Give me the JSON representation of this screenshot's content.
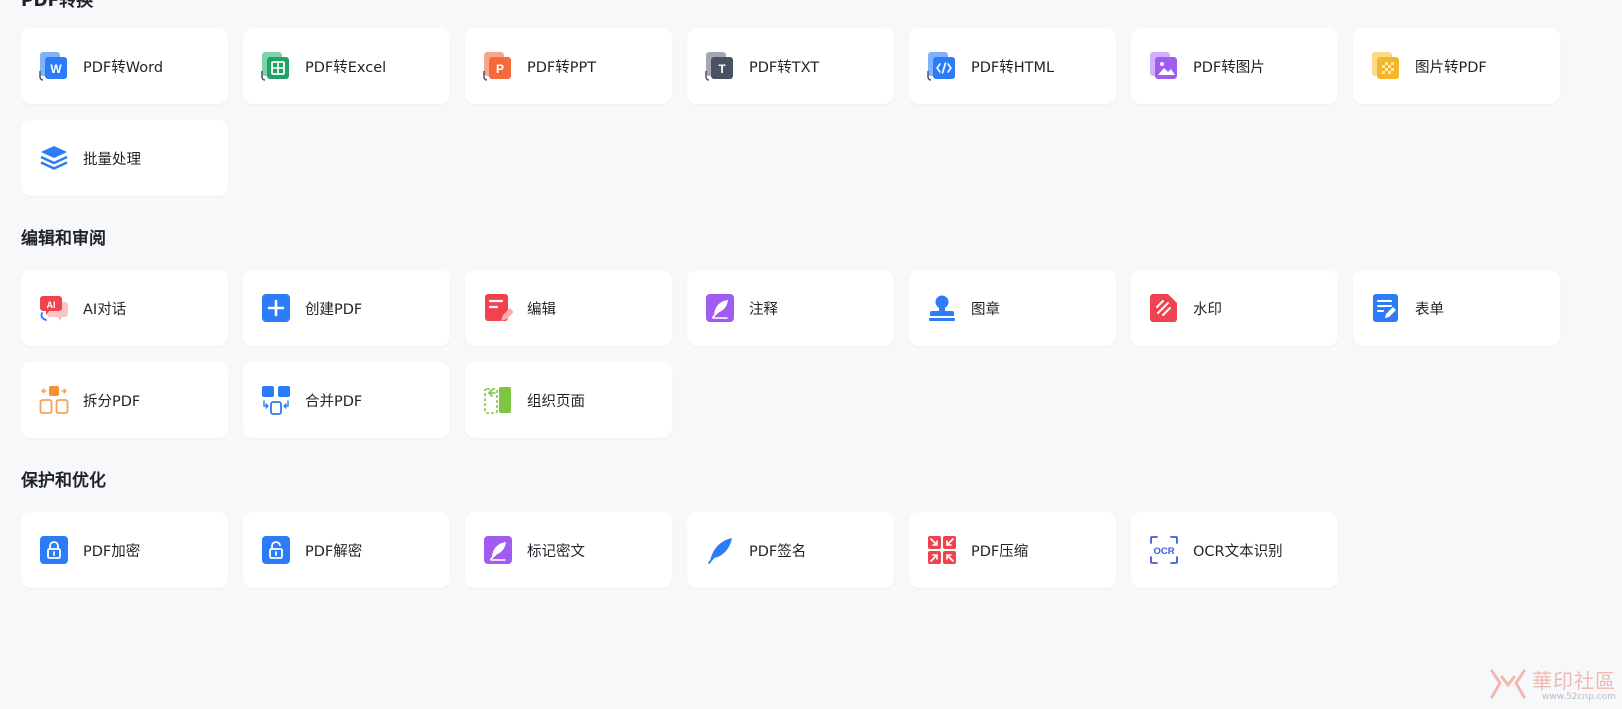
{
  "sections": [
    {
      "title": "PDF转换",
      "items": [
        {
          "label": "PDF转Word",
          "icon": "word-file-icon",
          "color": "#2b7cf6"
        },
        {
          "label": "PDF转Excel",
          "icon": "excel-file-icon",
          "color": "#21a366"
        },
        {
          "label": "PDF转PPT",
          "icon": "ppt-file-icon",
          "color": "#f36a3c"
        },
        {
          "label": "PDF转TXT",
          "icon": "txt-file-icon",
          "color": "#4a5262"
        },
        {
          "label": "PDF转HTML",
          "icon": "html-file-icon",
          "color": "#2b7cf6"
        },
        {
          "label": "PDF转图片",
          "icon": "image-file-icon",
          "color": "#a05bf0"
        },
        {
          "label": "图片转PDF",
          "icon": "image-to-pdf-icon",
          "color": "#f5b627"
        },
        {
          "label": "批量处理",
          "icon": "layers-icon",
          "color": "#2b7cf6"
        }
      ]
    },
    {
      "title": "编辑和审阅",
      "items": [
        {
          "label": "AI对话",
          "icon": "ai-chat-icon",
          "color": "#f0424f"
        },
        {
          "label": "创建PDF",
          "icon": "create-plus-icon",
          "color": "#2b7cf6"
        },
        {
          "label": "编辑",
          "icon": "edit-doc-icon",
          "color": "#f0424f"
        },
        {
          "label": "注释",
          "icon": "annotate-feather-icon",
          "color": "#a05bf0"
        },
        {
          "label": "图章",
          "icon": "stamp-icon",
          "color": "#2b7cf6"
        },
        {
          "label": "水印",
          "icon": "watermark-icon",
          "color": "#f0424f"
        },
        {
          "label": "表单",
          "icon": "form-icon",
          "color": "#2b7cf6"
        },
        {
          "label": "拆分PDF",
          "icon": "split-icon",
          "color": "#f5a15a"
        },
        {
          "label": "合并PDF",
          "icon": "merge-icon",
          "color": "#2b7cf6"
        },
        {
          "label": "组织页面",
          "icon": "organize-pages-icon",
          "color": "#7cc642"
        }
      ]
    },
    {
      "title": "保护和优化",
      "items": [
        {
          "label": "PDF加密",
          "icon": "lock-icon",
          "color": "#2b7cf6"
        },
        {
          "label": "PDF解密",
          "icon": "unlock-icon",
          "color": "#2b7cf6"
        },
        {
          "label": "标记密文",
          "icon": "redact-icon",
          "color": "#a05bf0"
        },
        {
          "label": "PDF签名",
          "icon": "signature-feather-icon",
          "color": "#2b7cf6"
        },
        {
          "label": "PDF压缩",
          "icon": "compress-icon",
          "color": "#f0424f"
        },
        {
          "label": "OCR文本识别",
          "icon": "ocr-icon",
          "color": "#3b5bdb"
        }
      ]
    }
  ],
  "watermark": {
    "main": "華印社區",
    "sub": "www.52cnp.com"
  }
}
